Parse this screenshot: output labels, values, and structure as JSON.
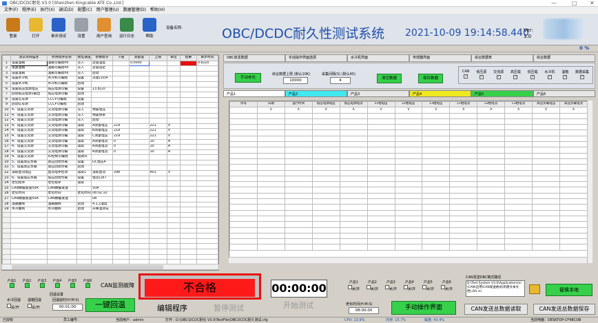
{
  "window": {
    "title": "OBC/DCDC耐化 V3.0 [Shenzhen Kingcable ATE Co.,Ltd.]"
  },
  "menu": [
    "文件(F)",
    "程序(E)",
    "执行(X)",
    "调试(D)",
    "配置(C)",
    "用户管理(U)",
    "数据管理(D)",
    "帮助(H)"
  ],
  "toolbar": [
    {
      "label": "登录",
      "icon": "users-icon",
      "color": "#c87a1a"
    },
    {
      "label": "打开",
      "icon": "folder-icon",
      "color": "#e8b830"
    },
    {
      "label": "单步测试",
      "icon": "step-icon",
      "color": "#2a62c8"
    },
    {
      "label": "设置",
      "icon": "tools-icon",
      "color": "#9aa0a8"
    },
    {
      "label": "用户查询",
      "icon": "user-query-icon",
      "color": "#e09030"
    },
    {
      "label": "运行日志",
      "icon": "log-icon",
      "color": "#3a8a4a"
    },
    {
      "label": "帮助",
      "icon": "help-icon",
      "color": "#2a62c8"
    }
  ],
  "device_label": "设备名称:",
  "system_title": "OBC/DCDC耐久性测试系统",
  "datetime": "2021-10-09 19:14:58.440",
  "version_label": "Ver:",
  "version": "3.0",
  "progress_text": "0 %",
  "left_table": {
    "headers": [
      "",
      "测试项目描述",
      "所用程序名称",
      "地址通道",
      "参数指令",
      "下限",
      "测量值",
      "上限",
      "单位",
      "结果",
      "单步时间"
    ],
    "rows": [
      [
        "1",
        "设置温箱",
        "温箱可编程ho",
        "写入",
        "定值温度",
        "",
        "0.0000",
        "",
        "",
        "",
        "0.622s"
      ],
      [
        "2",
        "设置温箱",
        "温箱可编程ho",
        "写入",
        "定值设定",
        "",
        "",
        "",
        "",
        "",
        ""
      ],
      [
        "3",
        "设置温箱",
        "温箱可编程ho",
        "写入",
        "启动",
        "",
        "",
        "",
        "",
        "",
        ""
      ],
      [
        "4",
        "设置水冷机",
        "水冷机可编程",
        "设置",
        "流量[10]4",
        "",
        "",
        "",
        "",
        "",
        ""
      ],
      [
        "5",
        "设置水冷机",
        "水冷机可编程",
        "启动",
        "",
        "",
        "",
        "",
        "",
        "",
        ""
      ],
      [
        "6",
        "设置低压电源电压",
        "低压电源可编",
        "设置",
        "13.8[10",
        "",
        "",
        "",
        "",
        "",
        ""
      ],
      [
        "7",
        "启动低压电源1输出",
        "低压电源可编",
        "启动",
        "",
        "",
        "",
        "",
        "",
        "",
        ""
      ],
      [
        "8",
        "设置信号源",
        "CCCP可编程",
        "设置",
        "",
        "",
        "",
        "",
        "",
        "",
        ""
      ],
      [
        "9",
        "启动信号源",
        "CCCP可编程",
        "启动",
        "",
        "",
        "",
        "",
        "",
        "",
        ""
      ],
      [
        "10",
        "4、设置交流源",
        "交流电源可编",
        "写入",
        "预置电压",
        "",
        "",
        "",
        "",
        "",
        ""
      ],
      [
        "11",
        "4、设置交流源",
        "交流电源可编",
        "写入",
        "预置频率",
        "",
        "",
        "",
        "",
        "",
        ""
      ],
      [
        "12",
        "4、设置交流源",
        "交流电源可编",
        "写入",
        "启动",
        "",
        "",
        "",
        "",
        "",
        ""
      ],
      [
        "13",
        "4、设置交流源",
        "交流电源可编",
        "读取",
        "A测量电压",
        "219",
        "",
        "221",
        "V",
        "",
        ""
      ],
      [
        "14",
        "4、设置交流源",
        "交流电源可编",
        "读取",
        "B测量电压",
        "219",
        "",
        "221",
        "V",
        "",
        ""
      ],
      [
        "15",
        "4、设置交流源",
        "交流电源可编",
        "读取",
        "C测量电压",
        "219",
        "",
        "221",
        "V",
        "",
        ""
      ],
      [
        "16",
        "4、设置交流源",
        "交流电源可编",
        "读取",
        "A测量电流",
        "0",
        "",
        "10",
        "A",
        "",
        ""
      ],
      [
        "17",
        "4、设置交流源",
        "交流电源可编",
        "读取",
        "A测量电流",
        "0",
        "",
        "10",
        "A",
        "",
        ""
      ],
      [
        "18",
        "4、设置交流源",
        "交流电源可编",
        "读取",
        "A测量电流",
        "0",
        "",
        "10",
        "A",
        "",
        ""
      ],
      [
        "19",
        "4、设置交流源",
        "IO控制可编程",
        "电源开",
        "",
        "",
        "",
        "",
        "",
        "",
        ""
      ],
      [
        "20",
        "5、设置高压负载",
        "高压回馈负载",
        "设置",
        "DC恒压4",
        "",
        "",
        "",
        "",
        "",
        ""
      ],
      [
        "21",
        "5、设置高压负载",
        "高压回馈负载",
        "启动",
        "",
        "",
        "",
        "",
        "",
        "",
        ""
      ],
      [
        "22",
        "读取直流电压",
        "直流电参检测",
        "读取1",
        "读取直流",
        "398",
        "",
        "401",
        "V",
        "",
        ""
      ],
      [
        "23",
        "6、设置低压负载",
        "低压回馈负载",
        "设置",
        "恒流[167",
        "",
        "",
        "",
        "",
        "",
        ""
      ],
      [
        "24",
        "老化程序",
        "老化程序",
        "读取",
        "",
        "",
        "",
        "",
        "",
        "",
        ""
      ],
      [
        "25",
        "CAN数据发送50A",
        "CAN数据发送",
        "",
        "50A",
        "",
        "",
        "",
        "",
        "",
        ""
      ],
      [
        "26",
        "老化时间",
        "老化时间",
        "老化时间",
        "08:02:10",
        "",
        "",
        "",
        "",
        "",
        ""
      ],
      [
        "27",
        "CAN数据发送50A",
        "CAN数据发送",
        "",
        "0A",
        "",
        "",
        "",
        "",
        "",
        ""
      ],
      [
        "28",
        "温箱曲线",
        "温箱曲线",
        "启动",
        "4.1.2温度",
        "",
        "",
        "",
        "",
        "",
        ""
      ],
      [
        "29",
        "水冷曲线",
        "水冷曲线",
        "启动",
        "升降温测试",
        "",
        "",
        "",
        "",
        "",
        ""
      ]
    ]
  },
  "top_tabs": [
    "OBC收发数据",
    "手动操作界面选择",
    "水冷机界面",
    "传感器界面",
    "综合数据表",
    "综合数据"
  ],
  "controls": {
    "manual_aging": "手动老化",
    "upper_limit_label": "综合数据上限 (默认10K)",
    "upper_limit_value": "10000",
    "interval_label": "采集间隔(S) (默认4S)",
    "interval_value": "4",
    "clear_btn": "清空数据",
    "save_btn": "保存数据",
    "checks": [
      "CAN",
      "低压源",
      "交流源",
      "高压载",
      "低压载",
      "水冷机",
      "温箱",
      "数据采集"
    ]
  },
  "product_tabs": [
    {
      "label": "产品1",
      "color": "#ffffff"
    },
    {
      "label": "产品2",
      "color": "#40e8f0"
    },
    {
      "label": "产品3",
      "color": "#e6e6e6"
    },
    {
      "label": "产品4",
      "color": "#f0e820"
    },
    {
      "label": "产品5",
      "color": "#36d04a"
    },
    {
      "label": "产品6",
      "color": "#e6e6e6"
    }
  ],
  "right_table": {
    "headers": [
      "序号",
      "日期",
      "运行时间",
      "低压电源电压",
      "低压电源电流",
      "L1相电压",
      "L2相电压",
      "L3相电压",
      "L1相电流",
      "L2相电流",
      "L3相电流",
      "高压负载电压",
      "高压负载电流"
    ],
    "units": [
      "",
      "V",
      "A",
      "V",
      "A",
      "V",
      "V",
      "V",
      "A",
      "A",
      "A",
      "V",
      "A"
    ]
  },
  "bottom": {
    "products": [
      "产品1",
      "产品2",
      "产品3",
      "产品4",
      "产品5",
      "产品6"
    ],
    "can_monitor": "CAN监测故障",
    "return_temp_label": "回温设置",
    "water_cool": "水冷回温",
    "temp_back": "温箱回温",
    "switch_on": "开",
    "switch_off": "关",
    "return_time_label": "回温延时(H:M:S)",
    "return_time": "00:01:00",
    "one_key": "一键回温",
    "fail_text": "不合格",
    "timer": "00:00:00",
    "edit_program": "编辑程序",
    "pause_test": "暂停测试",
    "start_test": "开始测试",
    "product_switches": [
      "产品1",
      "产品2",
      "产品3",
      "产品4",
      "产品5",
      "产品6"
    ],
    "aging_time_label": "老化时间(H:M:S)",
    "aging_time": "08:00:00",
    "manual_ui": "手动操作界面",
    "can_path_label": "CAN发送DBC格式路径",
    "can_path": "D:\\Test System V3.0\\Application\\ini\\CAN\\应用\\CAN发送格式(新建文本文档).DA.ini",
    "file_btn": "替换本地",
    "can_read": "CAN发送总数据读取",
    "can_save": "CAN发送总数据保存"
  },
  "status": {
    "auth": "已授权",
    "user_label": "员工编号：",
    "current_user": "当前用户：admin",
    "path": "打开：D:\\OBC\\DCDC耐化 V3.0\\TestFile\\OBCDCDC耐久测试.cfg",
    "cpu": "CPU: 13.9%",
    "mem": "内存: 15.7%",
    "disk": "磁盘: 43.4%",
    "host": "当前电脑：DESKTOP-CF48COB"
  }
}
